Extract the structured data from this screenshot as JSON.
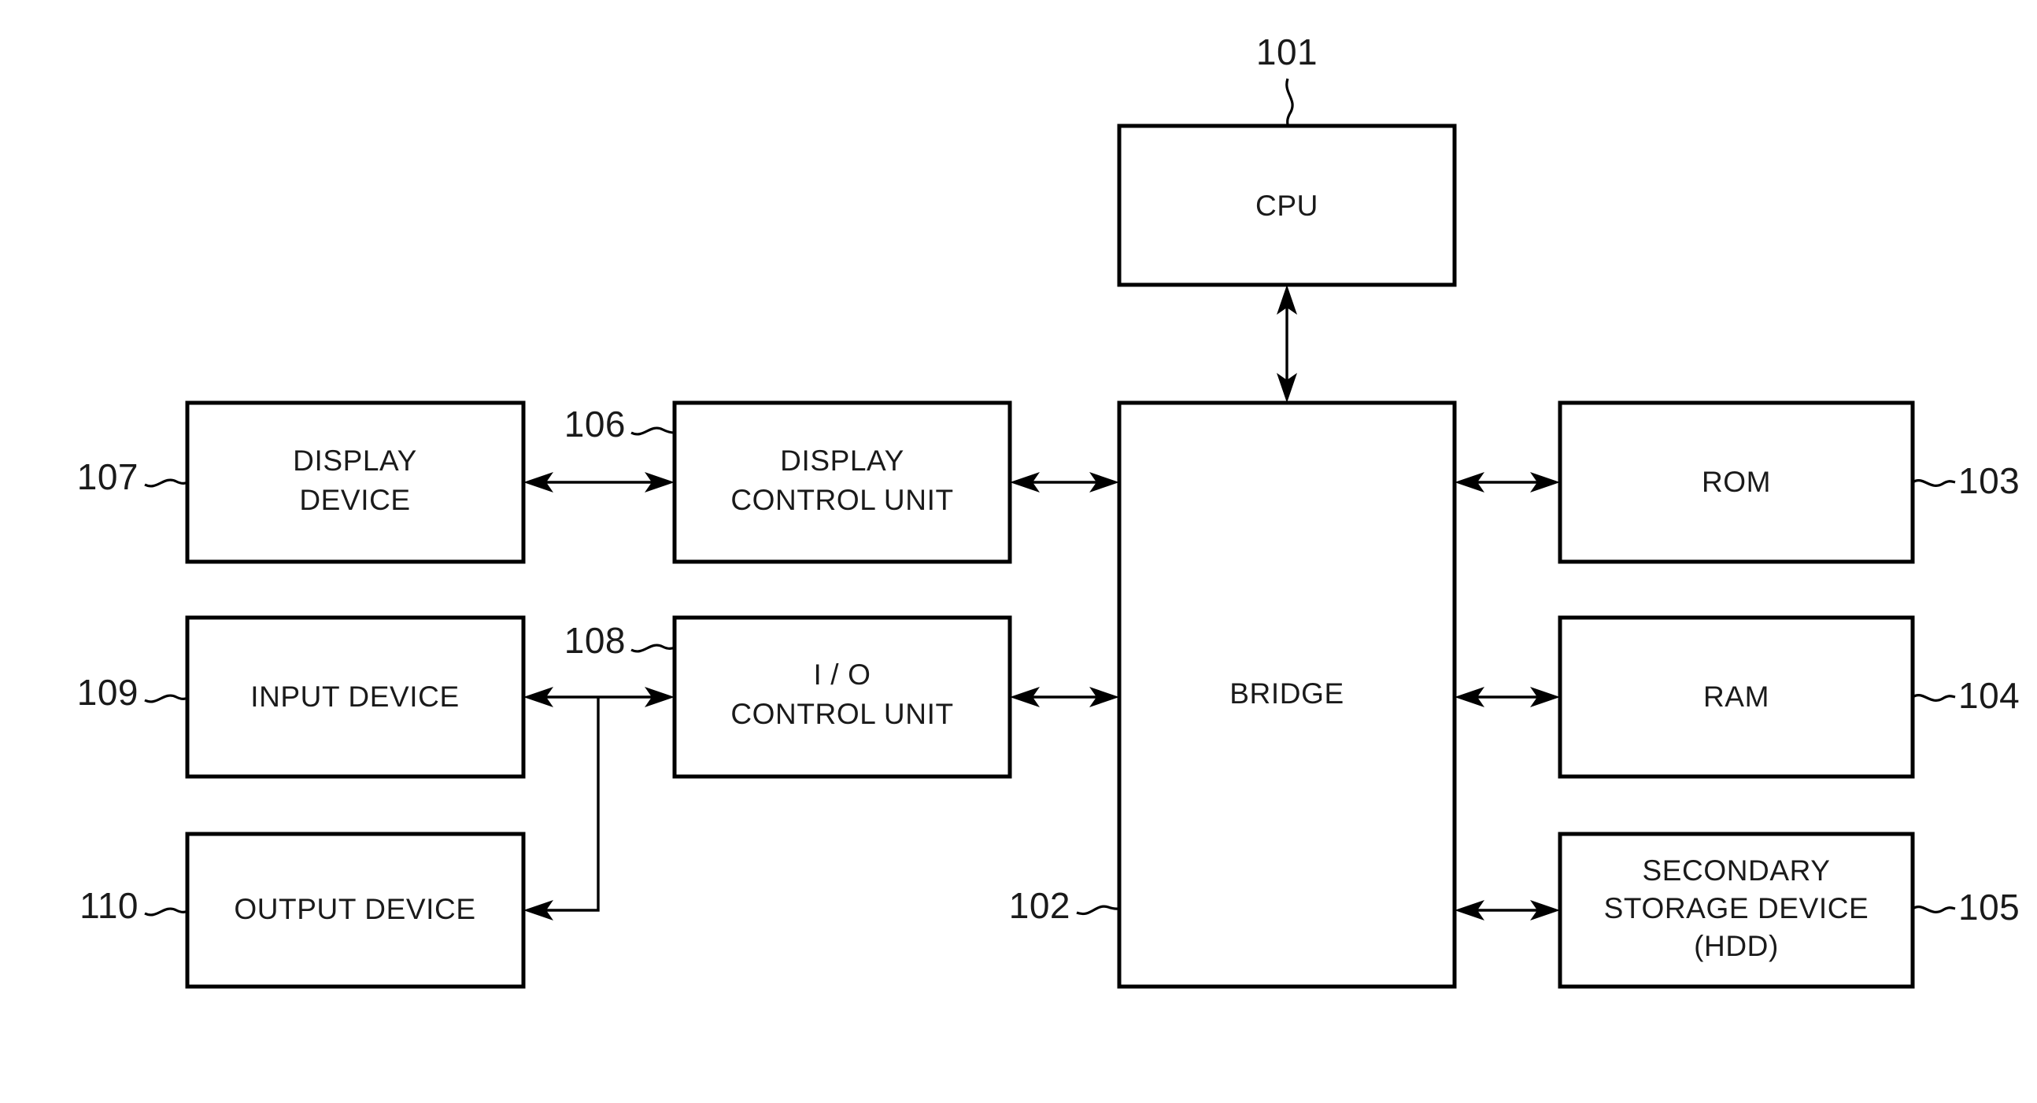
{
  "figure": {
    "title": "Computer hardware block diagram",
    "background_color": "#ffffff",
    "line_color": "#000000",
    "text_color": "#1a1a1a"
  },
  "blocks": {
    "cpu": {
      "label": "CPU",
      "ref": "101"
    },
    "bridge": {
      "label": "BRIDGE",
      "ref": "102"
    },
    "rom": {
      "label": "ROM",
      "ref": "103"
    },
    "ram": {
      "label": "RAM",
      "ref": "104"
    },
    "hdd_line1": {
      "label": "SECONDARY"
    },
    "hdd_line2": {
      "label": "STORAGE DEVICE"
    },
    "hdd_line3": {
      "label": "(HDD)"
    },
    "hdd": {
      "ref": "105"
    },
    "display_ctrl_line1": {
      "label": "DISPLAY"
    },
    "display_ctrl_line2": {
      "label": "CONTROL UNIT"
    },
    "display_ctrl": {
      "ref": "106"
    },
    "display_dev_line1": {
      "label": "DISPLAY"
    },
    "display_dev_line2": {
      "label": "DEVICE"
    },
    "display_dev": {
      "ref": "107"
    },
    "io_ctrl_line1": {
      "label": "I / O"
    },
    "io_ctrl_line2": {
      "label": "CONTROL UNIT"
    },
    "io_ctrl": {
      "ref": "108"
    },
    "input_dev": {
      "label": "INPUT DEVICE",
      "ref": "109"
    },
    "output_dev": {
      "label": "OUTPUT DEVICE",
      "ref": "110"
    }
  }
}
